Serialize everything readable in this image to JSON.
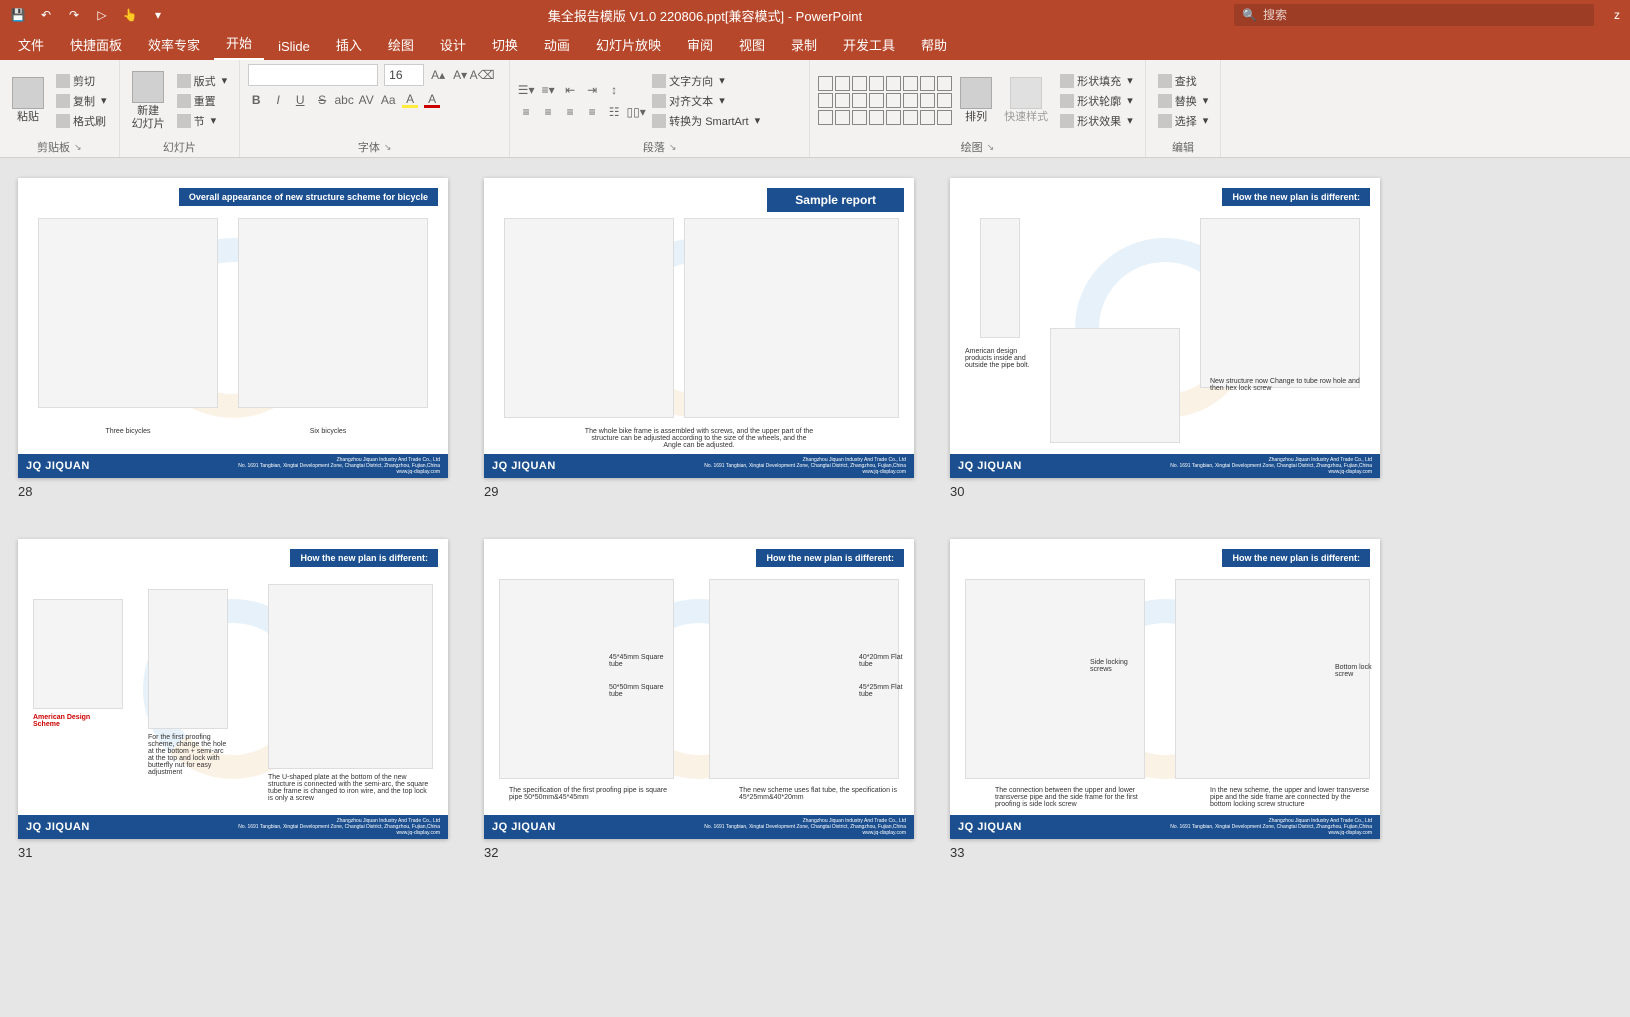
{
  "app": {
    "title_doc": "集全报告模版 V1.0 220806.ppt[兼容模式]",
    "app_name": "PowerPoint",
    "search_placeholder": "搜索",
    "user_initial": "z"
  },
  "qat": {
    "save": "💾",
    "undo": "↶",
    "redo": "↷",
    "start": "▷",
    "touch": "👆",
    "more": "▾"
  },
  "tabs": {
    "file": "文件",
    "quick": "快捷面板",
    "efficiency": "效率专家",
    "home": "开始",
    "islide": "iSlide",
    "insert": "插入",
    "draw": "绘图",
    "design": "设计",
    "transitions": "切换",
    "animations": "动画",
    "slideshow": "幻灯片放映",
    "review": "审阅",
    "view": "视图",
    "record": "录制",
    "devtools": "开发工具",
    "help": "帮助"
  },
  "ribbon": {
    "clipboard": {
      "label": "剪贴板",
      "paste": "粘贴",
      "cut": "剪切",
      "copy": "复制",
      "format_painter": "格式刷"
    },
    "slides": {
      "label": "幻灯片",
      "new_slide": "新建\n幻灯片",
      "layout": "版式",
      "reset": "重置",
      "section": "节"
    },
    "font": {
      "label": "字体",
      "size": "16",
      "bold": "B",
      "italic": "I",
      "underline": "U",
      "strike": "S",
      "shadow": "abc",
      "spacing": "AV",
      "case": "Aa",
      "clear": "A",
      "color": "A",
      "highlight": "A"
    },
    "paragraph": {
      "label": "段落",
      "text_direction": "文字方向",
      "align_text": "对齐文本",
      "smartart": "转换为 SmartArt"
    },
    "drawing": {
      "label": "绘图",
      "arrange": "排列",
      "quick_styles": "快速样式",
      "shape_fill": "形状填充",
      "shape_outline": "形状轮廓",
      "shape_effects": "形状效果"
    },
    "editing": {
      "label": "编辑",
      "find": "查找",
      "replace": "替换",
      "select": "选择"
    }
  },
  "slides": [
    {
      "num": "28",
      "tag": "Overall appearance of new structure scheme for bicycle",
      "cap1": "Three bicycles",
      "cap2": "Six bicycles",
      "brand": "JQ JIQUAN",
      "addr1": "Zhangzhou Jiquan Industry And Trade Co., Ltd",
      "addr2": "No. 1691 Tangbian, Xingtai Development Zone, Changtai District, Zhangzhou, Fujian,China",
      "addr3": "www.jq-display.com"
    },
    {
      "num": "29",
      "tag": "Sample report",
      "cap1": "The whole bike frame is assembled with screws, and the upper part of the structure can be adjusted according to the size of the wheels, and the Angle can be adjusted.",
      "brand": "JQ JIQUAN",
      "addr1": "Zhangzhou Jiquan Industry And Trade Co., Ltd",
      "addr2": "No. 1691 Tangbian, Xingtai Development Zone, Changtai District, Zhangzhou, Fujian,China",
      "addr3": "www.jq-display.com"
    },
    {
      "num": "30",
      "tag": "How the new plan is different:",
      "cap1": "American design products inside and outside the pipe bolt.",
      "cap2": "New structure now Change to tube row hole and then hex lock screw",
      "brand": "JQ JIQUAN",
      "addr1": "Zhangzhou Jiquan Industry And Trade Co., Ltd",
      "addr2": "No. 1691 Tangbian, Xingtai Development Zone, Changtai District, Zhangzhou, Fujian,China",
      "addr3": "www.jq-display.com"
    },
    {
      "num": "31",
      "tag": "How the new plan is different:",
      "cap_red": "American Design Scheme",
      "cap1": "For the first proofing scheme, change the hole at the bottom + semi-arc at the top and lock with butterfly nut for easy adjustment",
      "cap2": "The U-shaped plate at the bottom of the new structure is connected with the semi-arc, the square tube frame is changed to iron wire, and the top lock is only a screw",
      "brand": "JQ JIQUAN",
      "addr1": "Zhangzhou Jiquan Industry And Trade Co., Ltd",
      "addr2": "No. 1691 Tangbian, Xingtai Development Zone, Changtai District, Zhangzhou, Fujian,China",
      "addr3": "www.jq-display.com"
    },
    {
      "num": "32",
      "tag": "How the new plan is different:",
      "l1": "45*45mm Square tube",
      "l2": "50*50mm Square tube",
      "l3": "40*20mm Flat tube",
      "l4": "45*25mm Flat tube",
      "cap1": "The specification of the first proofing pipe is square pipe 50*50mm&45*45mm",
      "cap2": "The new scheme uses flat tube, the specification is 45*25mm&40*20mm",
      "brand": "JQ JIQUAN",
      "addr1": "Zhangzhou Jiquan Industry And Trade Co., Ltd",
      "addr2": "No. 1691 Tangbian, Xingtai Development Zone, Changtai District, Zhangzhou, Fujian,China",
      "addr3": "www.jq-display.com"
    },
    {
      "num": "33",
      "tag": "How the new plan is different:",
      "l1": "Side locking screws",
      "l2": "Bottom lock screw",
      "cap1": "The connection between the upper and lower transverse pipe and the side frame for the first proofing is side lock screw",
      "cap2": "In the new scheme, the upper and lower transverse pipe and the side frame are connected by the bottom locking screw structure",
      "brand": "JQ JIQUAN",
      "addr1": "Zhangzhou Jiquan Industry And Trade Co., Ltd",
      "addr2": "No. 1691 Tangbian, Xingtai Development Zone, Changtai District, Zhangzhou, Fujian,China",
      "addr3": "www.jq-display.com"
    }
  ]
}
